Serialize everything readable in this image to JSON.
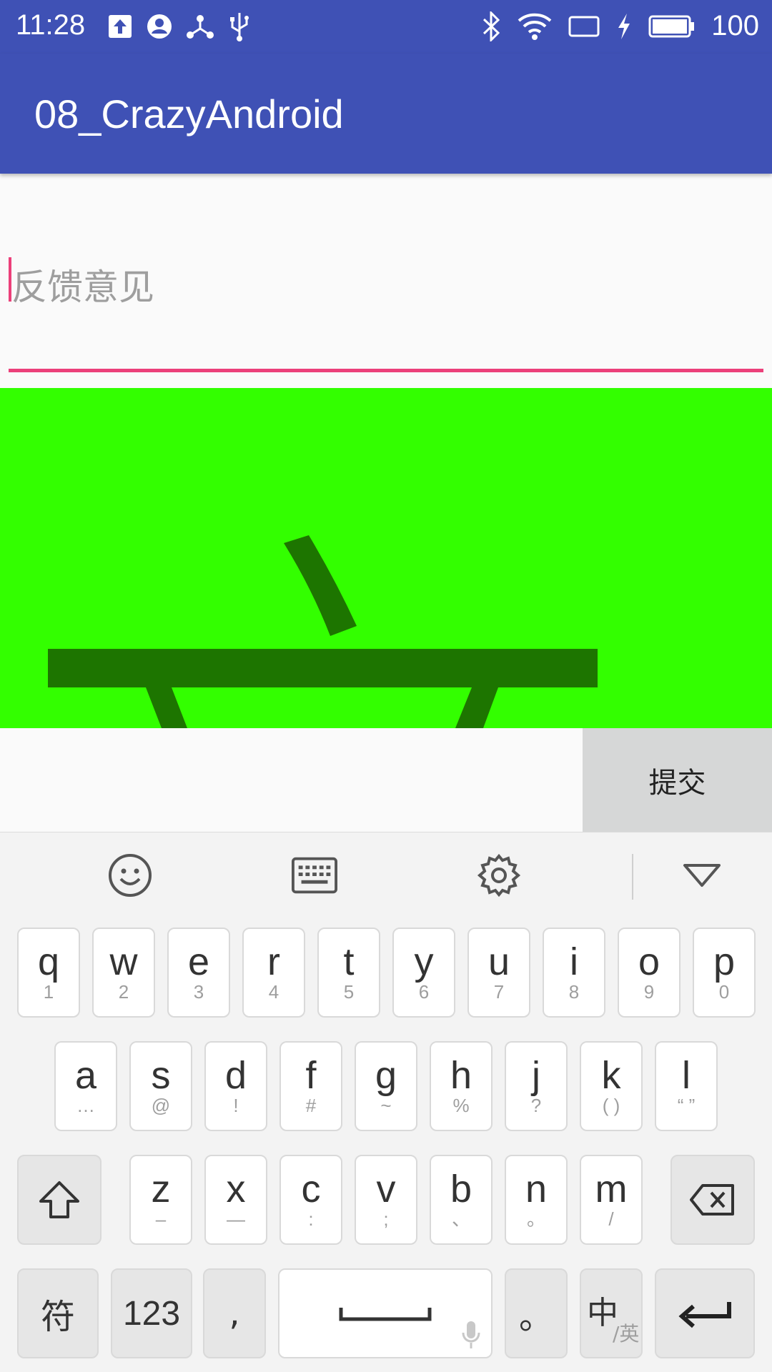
{
  "status_bar": {
    "time": "11:28",
    "battery_level": "100",
    "left_icons": [
      "upload-icon",
      "account-icon",
      "share-nodes-icon",
      "usb-icon"
    ],
    "right_icons": [
      "bluetooth-icon",
      "wifi-icon",
      "screen-cast-icon",
      "charging-icon",
      "battery-icon"
    ]
  },
  "app_bar": {
    "title": "08_CrazyAndroid"
  },
  "feedback_input": {
    "placeholder": "反馈意见",
    "value": ""
  },
  "submit_button": {
    "label": "提交"
  },
  "keyboard": {
    "toolbar": [
      "emoji-icon",
      "keyboard-icon",
      "settings-icon",
      "collapse-icon"
    ],
    "row1": [
      {
        "main": "q",
        "sub": "1"
      },
      {
        "main": "w",
        "sub": "2"
      },
      {
        "main": "e",
        "sub": "3"
      },
      {
        "main": "r",
        "sub": "4"
      },
      {
        "main": "t",
        "sub": "5"
      },
      {
        "main": "y",
        "sub": "6"
      },
      {
        "main": "u",
        "sub": "7"
      },
      {
        "main": "i",
        "sub": "8"
      },
      {
        "main": "o",
        "sub": "9"
      },
      {
        "main": "p",
        "sub": "0"
      }
    ],
    "row2": [
      {
        "main": "a",
        "sub": "…"
      },
      {
        "main": "s",
        "sub": "@"
      },
      {
        "main": "d",
        "sub": "!"
      },
      {
        "main": "f",
        "sub": "#"
      },
      {
        "main": "g",
        "sub": "~"
      },
      {
        "main": "h",
        "sub": "%"
      },
      {
        "main": "j",
        "sub": "?"
      },
      {
        "main": "k",
        "sub": "( )"
      },
      {
        "main": "l",
        "sub": "“ ”"
      }
    ],
    "row3": [
      {
        "main": "z",
        "sub": "–"
      },
      {
        "main": "x",
        "sub": "—"
      },
      {
        "main": "c",
        "sub": ":"
      },
      {
        "main": "v",
        "sub": ";"
      },
      {
        "main": "b",
        "sub": "、"
      },
      {
        "main": "n",
        "sub": "。"
      },
      {
        "main": "m",
        "sub": "/"
      }
    ],
    "symbols_label": "符",
    "numbers_label": "123",
    "comma_label": ",",
    "period_label": "。",
    "lang_main": "中",
    "lang_sub": "/英"
  }
}
